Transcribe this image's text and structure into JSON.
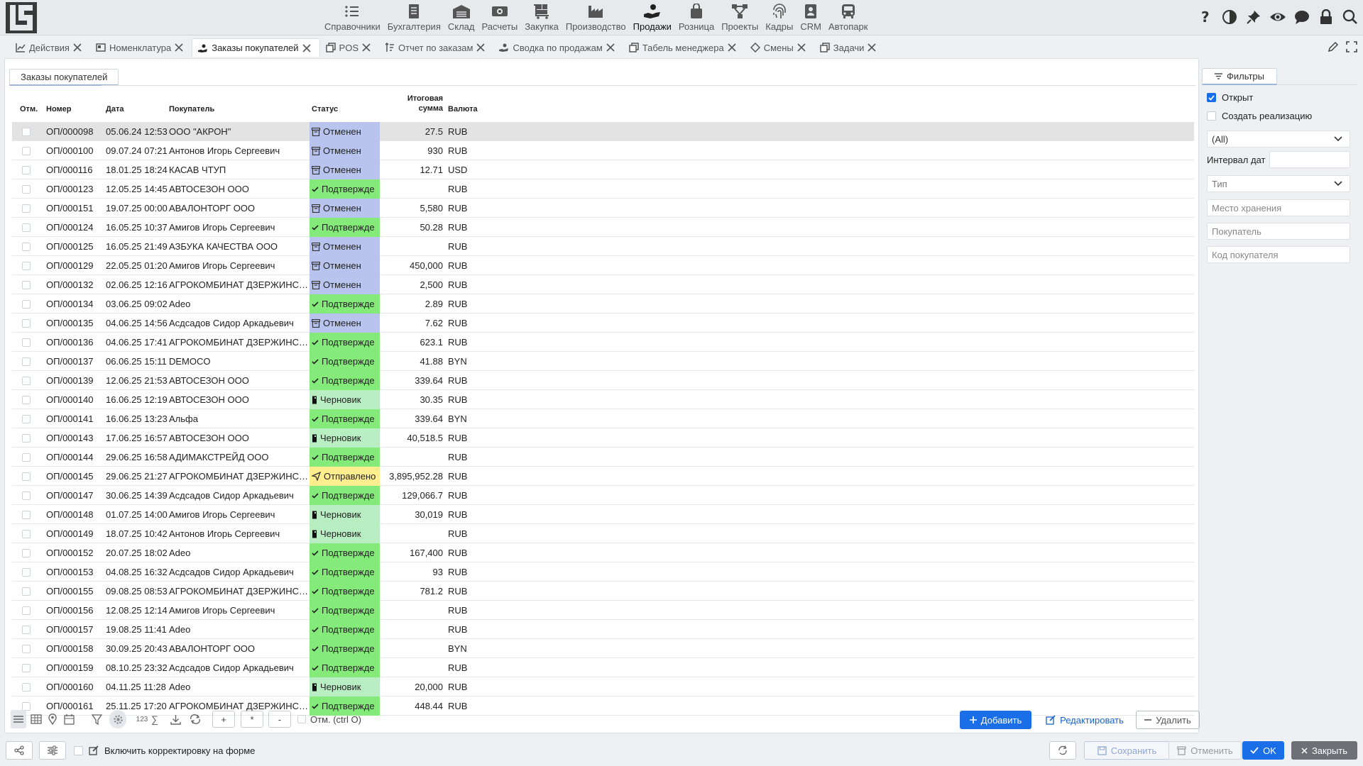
{
  "app": {
    "logo": "app-logo"
  },
  "topnav": [
    {
      "id": "references",
      "label": "Справочники",
      "icon": "list-icon"
    },
    {
      "id": "accounting",
      "label": "Бухгалтерия",
      "icon": "ledger-icon"
    },
    {
      "id": "warehouse",
      "label": "Склад",
      "icon": "warehouse-icon"
    },
    {
      "id": "payments",
      "label": "Расчеты",
      "icon": "money-icon"
    },
    {
      "id": "purchase",
      "label": "Закупка",
      "icon": "cart-icon"
    },
    {
      "id": "production",
      "label": "Производство",
      "icon": "factory-icon"
    },
    {
      "id": "sales",
      "label": "Продажи",
      "icon": "hand-coin-icon",
      "active": true
    },
    {
      "id": "retail",
      "label": "Розница",
      "icon": "shopping-bag-icon"
    },
    {
      "id": "projects",
      "label": "Проекты",
      "icon": "hierarchy-icon"
    },
    {
      "id": "hr",
      "label": "Кадры",
      "icon": "fingerprint-icon"
    },
    {
      "id": "crm",
      "label": "CRM",
      "icon": "contact-card-icon"
    },
    {
      "id": "fleet",
      "label": "Автопарк",
      "icon": "bus-icon"
    }
  ],
  "top_icons": [
    "help-icon",
    "contrast-icon",
    "pin-icon",
    "eye-icon",
    "chat-icon",
    "lock-icon",
    "search-icon"
  ],
  "tabs": [
    {
      "label": "Действия",
      "icon": "chart-icon"
    },
    {
      "label": "Номенклатура",
      "icon": "catalog-icon"
    },
    {
      "label": "Заказы покупателей",
      "icon": "hand-coin-icon",
      "active": true
    },
    {
      "label": "POS",
      "icon": "copy-icon"
    },
    {
      "label": "Отчет по заказам",
      "icon": "sort-icon"
    },
    {
      "label": "Сводка по продажам",
      "icon": "hand-coin-icon"
    },
    {
      "label": "Табель менеджера",
      "icon": "copy-icon"
    },
    {
      "label": "Смены",
      "icon": "diamond-icon"
    },
    {
      "label": "Задачи",
      "icon": "copy-icon"
    }
  ],
  "inner_tab": "Заказы покупателей",
  "columns": {
    "mark": "Отм.",
    "number": "Номер",
    "date": "Дата",
    "buyer": "Покупатель",
    "status": "Статус",
    "total_1": "Итоговая",
    "total_2": "сумма",
    "currency": "Валюта"
  },
  "rows": [
    {
      "number": "ОП/000098",
      "date": "05.06.24 12:53",
      "buyer": "ООО \"АКРОН\"",
      "status": "cancel",
      "status_label": "Отменен",
      "total": "27.5",
      "currency": "RUB",
      "selected": true
    },
    {
      "number": "ОП/000100",
      "date": "09.07.24 07:21",
      "buyer": "Антонов Игорь Сергеевич",
      "status": "cancel",
      "status_label": "Отменен",
      "total": "930",
      "currency": "RUB"
    },
    {
      "number": "ОП/000116",
      "date": "18.01.25 18:24",
      "buyer": "КАСАВ ЧТУП",
      "status": "cancel",
      "status_label": "Отменен",
      "total": "12.71",
      "currency": "USD"
    },
    {
      "number": "ОП/000123",
      "date": "12.05.25 14:45",
      "buyer": "АВТОСЕЗОН ООО",
      "status": "confirm",
      "status_label": "Подтвержде",
      "total": "",
      "currency": "RUB"
    },
    {
      "number": "ОП/000151",
      "date": "19.07.25 00:00",
      "buyer": "АВАЛОНТОРГ ООО",
      "status": "cancel",
      "status_label": "Отменен",
      "total": "5,580",
      "currency": "RUB"
    },
    {
      "number": "ОП/000124",
      "date": "16.05.25 10:37",
      "buyer": "Амигов Игорь Сергеевич",
      "status": "confirm",
      "status_label": "Подтвержде",
      "total": "50.28",
      "currency": "RUB"
    },
    {
      "number": "ОП/000125",
      "date": "16.05.25 21:49",
      "buyer": "АЗБУКА КАЧЕСТВА ООО",
      "status": "cancel",
      "status_label": "Отменен",
      "total": "",
      "currency": "RUB"
    },
    {
      "number": "ОП/000129",
      "date": "22.05.25 01:20",
      "buyer": "Амигов Игорь Сергеевич",
      "status": "cancel",
      "status_label": "Отменен",
      "total": "450,000",
      "currency": "RUB"
    },
    {
      "number": "ОП/000132",
      "date": "02.06.25 12:16",
      "buyer": "АГРОКОМБИНАТ ДЗЕРЖИНСК...",
      "status": "cancel",
      "status_label": "Отменен",
      "total": "2,500",
      "currency": "RUB"
    },
    {
      "number": "ОП/000134",
      "date": "03.06.25 09:02",
      "buyer": "Adeo",
      "status": "confirm",
      "status_label": "Подтвержде",
      "total": "2.89",
      "currency": "RUB"
    },
    {
      "number": "ОП/000135",
      "date": "04.06.25 14:56",
      "buyer": "Асдсадов Сидор Аркадьевич",
      "status": "cancel",
      "status_label": "Отменен",
      "total": "7.62",
      "currency": "RUB"
    },
    {
      "number": "ОП/000136",
      "date": "04.06.25 17:41",
      "buyer": "АГРОКОМБИНАТ ДЗЕРЖИНСК...",
      "status": "confirm",
      "status_label": "Подтвержде",
      "total": "623.1",
      "currency": "RUB"
    },
    {
      "number": "ОП/000137",
      "date": "06.06.25 15:11",
      "buyer": "DEMOCO",
      "status": "confirm",
      "status_label": "Подтвержде",
      "total": "41.88",
      "currency": "BYN"
    },
    {
      "number": "ОП/000139",
      "date": "12.06.25 21:53",
      "buyer": "АВТОСЕЗОН ООО",
      "status": "confirm",
      "status_label": "Подтвержде",
      "total": "339.64",
      "currency": "RUB"
    },
    {
      "number": "ОП/000140",
      "date": "16.06.25 12:19",
      "buyer": "АВТОСЕЗОН ООО",
      "status": "draft",
      "status_label": "Черновик",
      "total": "30.35",
      "currency": "RUB"
    },
    {
      "number": "ОП/000141",
      "date": "16.06.25 13:23",
      "buyer": "Альфа",
      "status": "confirm",
      "status_label": "Подтвержде",
      "total": "339.64",
      "currency": "BYN"
    },
    {
      "number": "ОП/000143",
      "date": "17.06.25 16:57",
      "buyer": "АВТОСЕЗОН ООО",
      "status": "draft",
      "status_label": "Черновик",
      "total": "40,518.5",
      "currency": "RUB"
    },
    {
      "number": "ОП/000144",
      "date": "29.06.25 16:58",
      "buyer": "АДИМАКСТРЕЙД ООО",
      "status": "confirm",
      "status_label": "Подтвержде",
      "total": "",
      "currency": "RUB"
    },
    {
      "number": "ОП/000145",
      "date": "29.06.25 21:27",
      "buyer": "АГРОКОМБИНАТ ДЗЕРЖИНСК...",
      "status": "sent",
      "status_label": "Отправлено",
      "total": "3,895,952.28",
      "currency": "RUB"
    },
    {
      "number": "ОП/000147",
      "date": "30.06.25 14:39",
      "buyer": "Асдсадов Сидор Аркадьевич",
      "status": "confirm",
      "status_label": "Подтвержде",
      "total": "129,066.7",
      "currency": "RUB"
    },
    {
      "number": "ОП/000148",
      "date": "01.07.25 14:00",
      "buyer": "Амигов Игорь Сергеевич",
      "status": "draft",
      "status_label": "Черновик",
      "total": "30,019",
      "currency": "RUB"
    },
    {
      "number": "ОП/000149",
      "date": "18.07.25 10:42",
      "buyer": "Антонов Игорь Сергеевич",
      "status": "draft",
      "status_label": "Черновик",
      "total": "",
      "currency": "RUB"
    },
    {
      "number": "ОП/000152",
      "date": "20.07.25 18:02",
      "buyer": "Adeo",
      "status": "confirm",
      "status_label": "Подтвержде",
      "total": "167,400",
      "currency": "RUB"
    },
    {
      "number": "ОП/000153",
      "date": "04.08.25 16:32",
      "buyer": "Асдсадов Сидор Аркадьевич",
      "status": "confirm",
      "status_label": "Подтвержде",
      "total": "93",
      "currency": "RUB"
    },
    {
      "number": "ОП/000155",
      "date": "09.08.25 08:53",
      "buyer": "АГРОКОМБИНАТ ДЗЕРЖИНСК...",
      "status": "confirm",
      "status_label": "Подтвержде",
      "total": "781.2",
      "currency": "RUB"
    },
    {
      "number": "ОП/000156",
      "date": "12.08.25 12:14",
      "buyer": "Амигов Игорь Сергеевич",
      "status": "confirm",
      "status_label": "Подтвержде",
      "total": "",
      "currency": "RUB"
    },
    {
      "number": "ОП/000157",
      "date": "19.08.25 11:41",
      "buyer": "Adeo",
      "status": "confirm",
      "status_label": "Подтвержде",
      "total": "",
      "currency": "RUB"
    },
    {
      "number": "ОП/000158",
      "date": "30.09.25 20:43",
      "buyer": "АВАЛОНТОРГ ООО",
      "status": "confirm",
      "status_label": "Подтвержде",
      "total": "",
      "currency": "BYN"
    },
    {
      "number": "ОП/000159",
      "date": "08.10.25 23:32",
      "buyer": "Асдсадов Сидор Аркадьевич",
      "status": "confirm",
      "status_label": "Подтвержде",
      "total": "",
      "currency": "RUB"
    },
    {
      "number": "ОП/000160",
      "date": "04.11.25 11:28",
      "buyer": "Adeo",
      "status": "draft",
      "status_label": "Черновик",
      "total": "20,000",
      "currency": "RUB"
    },
    {
      "number": "ОП/000161",
      "date": "25.11.25 17:20",
      "buyer": "АГРОКОМБИНАТ ДЗЕРЖИНСК...",
      "status": "confirm",
      "status_label": "Подтвержде",
      "total": "448.44",
      "currency": "RUB"
    }
  ],
  "status_colors": {
    "cancel": "#b9c4ee",
    "confirm": "#84ea79",
    "draft": "#b9eec3",
    "sent": "#ffee8e"
  },
  "bottom_toolbar": {
    "num_label": "123",
    "sum_label": "∑",
    "plus": "+",
    "star": "*",
    "minus": "-",
    "mark_label": "Отм. (ctrl O)"
  },
  "actions": {
    "add": "Добавить",
    "edit": "Редактировать",
    "delete": "Удалить"
  },
  "filters": {
    "tab_label": "Фильтры",
    "open_label": "Открыт",
    "open_checked": true,
    "create_sale_label": "Создать реализацию",
    "create_sale_checked": false,
    "select_all": "(All)",
    "date_interval_label": "Интервал дат",
    "type_placeholder": "Тип",
    "storage_placeholder": "Место хранения",
    "buyer_placeholder": "Покупатель",
    "buyer_code_placeholder": "Код покупателя"
  },
  "footer": {
    "correction_label": "Включить корректировку на форме",
    "save": "Сохранить",
    "cancel": "Отменить",
    "ok": "OK",
    "close": "Закрыть"
  },
  "accent_color": "#1a6ee8"
}
